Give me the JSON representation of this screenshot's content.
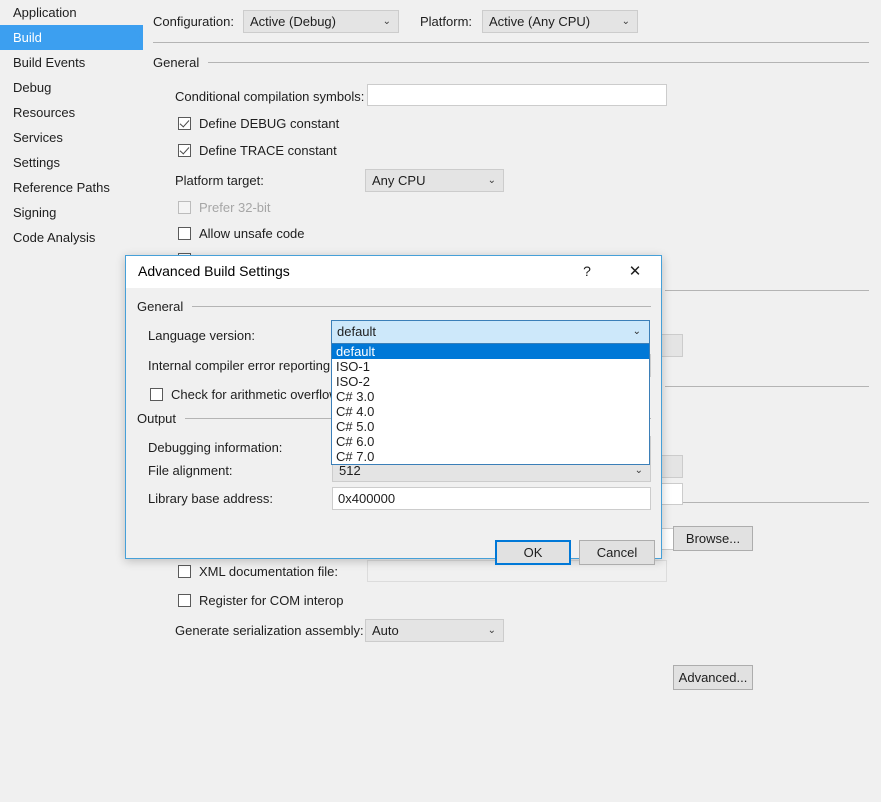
{
  "sidebar": {
    "items": [
      {
        "label": "Application",
        "selected": false
      },
      {
        "label": "Build",
        "selected": true
      },
      {
        "label": "Build Events",
        "selected": false
      },
      {
        "label": "Debug",
        "selected": false
      },
      {
        "label": "Resources",
        "selected": false
      },
      {
        "label": "Services",
        "selected": false
      },
      {
        "label": "Settings",
        "selected": false
      },
      {
        "label": "Reference Paths",
        "selected": false
      },
      {
        "label": "Signing",
        "selected": false
      },
      {
        "label": "Code Analysis",
        "selected": false
      }
    ]
  },
  "toolbar": {
    "configuration_label": "Configuration:",
    "configuration_value": "Active (Debug)",
    "platform_label": "Platform:",
    "platform_value": "Active (Any CPU)"
  },
  "build_page": {
    "general_group": "General",
    "conditional_symbols_label": "Conditional compilation symbols:",
    "conditional_symbols_value": "",
    "define_debug_label": "Define DEBUG constant",
    "define_debug_checked": true,
    "define_trace_label": "Define TRACE constant",
    "define_trace_checked": true,
    "platform_target_label": "Platform target:",
    "platform_target_value": "Any CPU",
    "prefer_32bit_label": "Prefer 32-bit",
    "prefer_32bit_checked": false,
    "allow_unsafe_label": "Allow unsafe code",
    "allow_unsafe_checked": false,
    "xml_doc_label": "XML documentation file:",
    "xml_doc_checked": false,
    "xml_doc_value": "",
    "com_interop_label": "Register for COM interop",
    "com_interop_checked": false,
    "serialization_label": "Generate serialization assembly:",
    "serialization_value": "Auto",
    "browse_button": "Browse...",
    "advanced_button": "Advanced..."
  },
  "dialog": {
    "title": "Advanced Build Settings",
    "help_icon": "?",
    "close_icon": "✕",
    "general_group": "General",
    "language_version_label": "Language version:",
    "language_version_value": "default",
    "internal_error_label": "Internal compiler error reporting:",
    "arithmetic_overflow_label": "Check for arithmetic overflow/u",
    "arithmetic_overflow_checked": false,
    "output_group": "Output",
    "debugging_info_label": "Debugging information:",
    "file_alignment_label": "File alignment:",
    "file_alignment_value": "512",
    "library_base_label": "Library base address:",
    "library_base_value": "0x400000",
    "ok_button": "OK",
    "cancel_button": "Cancel",
    "language_options": [
      {
        "label": "default",
        "selected": true
      },
      {
        "label": "ISO-1",
        "selected": false
      },
      {
        "label": "ISO-2",
        "selected": false
      },
      {
        "label": "C# 3.0",
        "selected": false
      },
      {
        "label": "C# 4.0",
        "selected": false
      },
      {
        "label": "C# 5.0",
        "selected": false
      },
      {
        "label": "C# 6.0",
        "selected": false
      },
      {
        "label": "C# 7.0",
        "selected": false
      }
    ]
  },
  "icons": {
    "chevron_down": "⌄"
  },
  "colors": {
    "accent_blue": "#3c9ff0",
    "selection_blue": "#0078d7",
    "dialog_border": "#46a0d8",
    "page_bg": "#f0f0f0"
  }
}
